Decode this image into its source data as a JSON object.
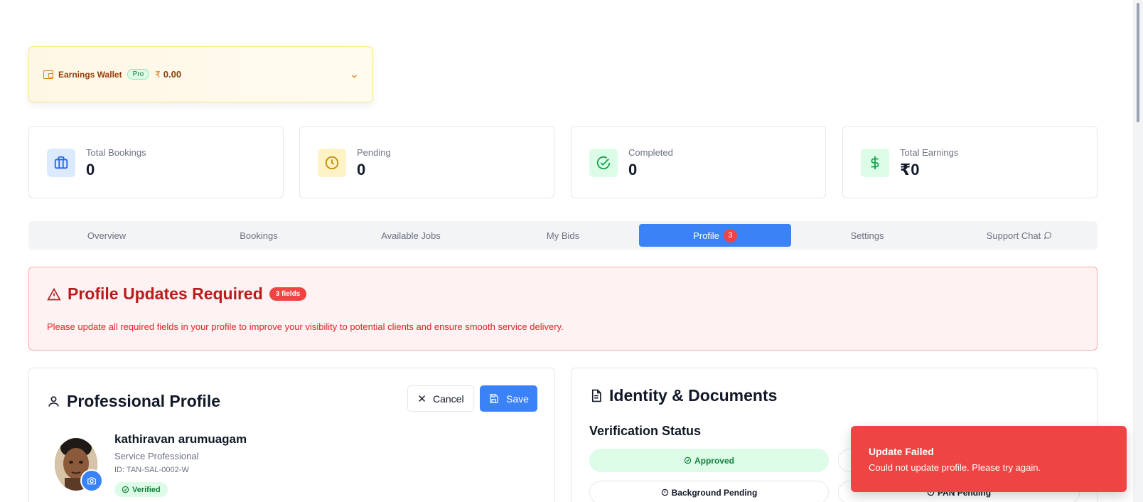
{
  "wallet": {
    "label": "Earnings Wallet",
    "badge": "Pro",
    "currency": "₹",
    "amount": "0.00",
    "icon": "wallet-icon",
    "toggle_icon": "chevron-down-icon"
  },
  "stats": [
    {
      "label": "Total Bookings",
      "value": "0",
      "icon": "briefcase-icon",
      "color": "#2563eb",
      "bg": "#dbeafe"
    },
    {
      "label": "Pending",
      "value": "0",
      "icon": "clock-icon",
      "color": "#ca8a04",
      "bg": "#fef3c7"
    },
    {
      "label": "Completed",
      "value": "0",
      "icon": "check-circle-icon",
      "color": "#16a34a",
      "bg": "#dcfce7"
    },
    {
      "label": "Total Earnings",
      "value": "₹0",
      "icon": "dollar-icon",
      "color": "#16a34a",
      "bg": "#dcfce7"
    }
  ],
  "tabs": [
    {
      "label": "Overview"
    },
    {
      "label": "Bookings"
    },
    {
      "label": "Available Jobs"
    },
    {
      "label": "My Bids"
    },
    {
      "label": "Profile",
      "badge": "3",
      "active": true
    },
    {
      "label": "Settings"
    },
    {
      "label": "Support Chat",
      "icon": "chat-icon"
    }
  ],
  "alert": {
    "title": "Profile Updates Required",
    "badge": "3 fields",
    "description": "Please update all required fields in your profile to improve your visibility to potential clients and ensure smooth service delivery.",
    "icon": "warning-icon",
    "color": "#b91c1c"
  },
  "profile": {
    "title": "Professional Profile",
    "cancel_label": "Cancel",
    "save_label": "Save",
    "name": "kathiravan arumuagam",
    "role": "Service Professional",
    "id": "ID: TAN-SAL-0002-W",
    "status": "Verified"
  },
  "identity": {
    "title": "Identity & Documents",
    "verification_title": "Verification Status",
    "statuses": [
      "Approved",
      "Background Pending",
      "PAN Pending"
    ]
  },
  "toast": {
    "title": "Update Failed",
    "message": "Could not update profile. Please try again.",
    "color": "#ef4444"
  },
  "accent": "#3b82f6"
}
